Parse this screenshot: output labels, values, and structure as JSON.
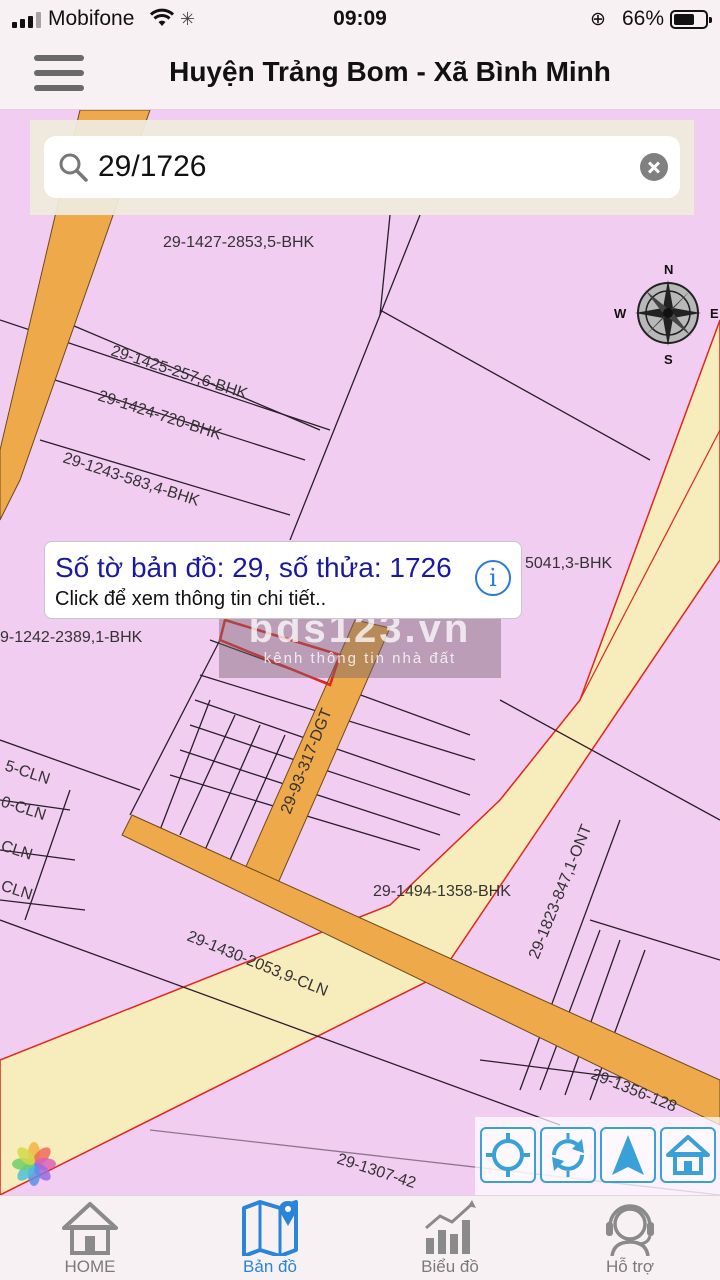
{
  "status_bar": {
    "carrier": "Mobifone",
    "time": "09:09",
    "battery_percent": "66%",
    "battery_level": 0.66
  },
  "header": {
    "title": "Huyện Trảng Bom - Xã Bình Minh",
    "menu_icon": "hamburger-icon"
  },
  "search": {
    "value": "29/1726",
    "search_icon": "search-icon",
    "clear_icon": "clear-icon"
  },
  "map": {
    "compass": {
      "n": "N",
      "s": "S",
      "e": "E",
      "w": "W"
    },
    "parcel_labels": [
      "29-1427-2853,5-BHK",
      "29-1425-257,6-BHK",
      "29-1424-720-BHK",
      "29-1243-583,4-BHK",
      "5041,3-BHK",
      "9-1242-2389,1-BHK",
      "29-93-317-DGT",
      "5-CLN",
      "0-CLN",
      "CLN",
      "CLN",
      "29-1494-1358-BHK",
      "29-1823-847,1-ONT",
      "29-1430-2053,9-CLN",
      "29-1356-128",
      "29-1307-42"
    ],
    "colors": {
      "land": "#f2cdf2",
      "road_orange": "#eda94a",
      "road_yellow": "#f7ecbc",
      "highlight": "#e2261c"
    }
  },
  "popup": {
    "title": "Số tờ bản đồ: 29, số thửa: 1726",
    "subtitle": "Click để xem thông tin chi tiết..",
    "info_icon": "i"
  },
  "watermark": {
    "main": "bds123.vn",
    "sub": "kênh thông tin nhà đất"
  },
  "tools": [
    "locate-icon",
    "refresh-icon",
    "navigate-icon",
    "home-icon"
  ],
  "bottom_nav": [
    {
      "label": "HOME",
      "icon": "home-icon",
      "active": false
    },
    {
      "label": "Bản đồ",
      "icon": "map-icon",
      "active": true
    },
    {
      "label": "Biểu đồ",
      "icon": "chart-icon",
      "active": false
    },
    {
      "label": "Hỗ trợ",
      "icon": "support-icon",
      "active": false
    }
  ]
}
